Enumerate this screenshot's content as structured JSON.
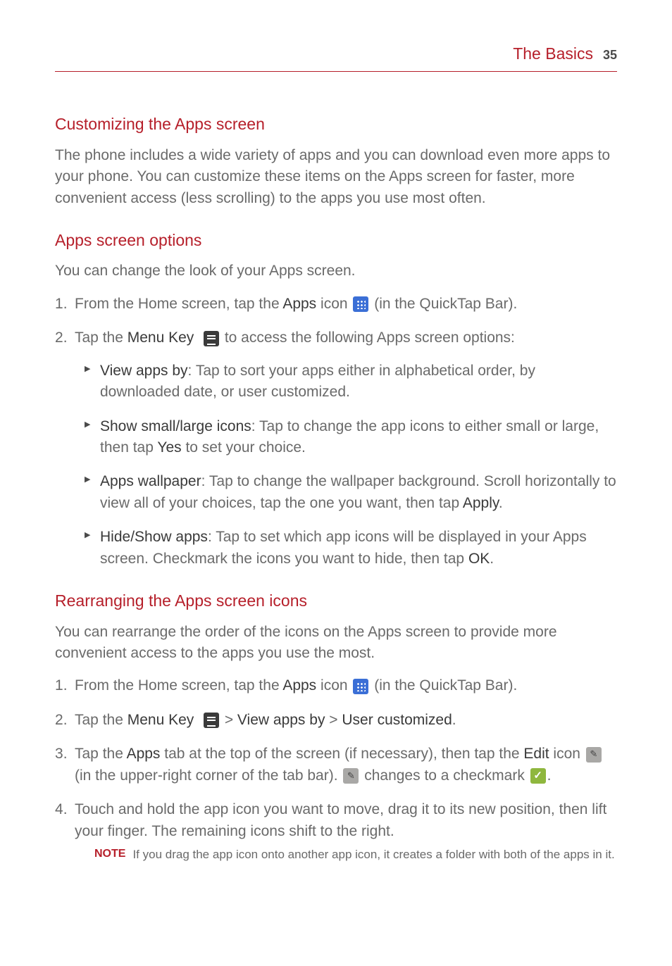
{
  "header": {
    "section": "The Basics",
    "page": "35"
  },
  "s1": {
    "title": "Customizing the Apps screen",
    "body": "The phone includes a wide variety of apps and you can download even more apps to your phone. You can customize these items on the Apps screen for faster, more convenient access (less scrolling) to the apps you use most often."
  },
  "s2": {
    "title": "Apps screen options",
    "body": "You can change the look of your Apps screen.",
    "step1_a": "From the Home screen, tap the ",
    "step1_b": "Apps",
    "step1_c": " icon ",
    "step1_d": " (in the QuickTap Bar).",
    "step2_a": "Tap the ",
    "step2_b": "Menu Key",
    "step2_c": " to access the following Apps screen options:",
    "bullets": {
      "b1_a": "View apps by",
      "b1_b": ": Tap to sort your apps either in alphabetical order, by downloaded date, or user customized.",
      "b2_a": "Show small/large icons",
      "b2_b": ": Tap to change the app icons to either small or large, then tap ",
      "b2_c": "Yes",
      "b2_d": " to set your choice.",
      "b3_a": "Apps wallpaper",
      "b3_b": ": Tap to change the wallpaper background. Scroll horizontally to view all of your choices, tap the one you want, then tap ",
      "b3_c": "Apply",
      "b3_d": ".",
      "b4_a": "Hide/Show apps",
      "b4_b": ": Tap to set which app icons will be displayed in your Apps screen. Checkmark the icons you want to hide, then tap ",
      "b4_c": "OK",
      "b4_d": "."
    }
  },
  "s3": {
    "title": "Rearranging the Apps screen icons",
    "body": "You can rearrange the order of the icons on the Apps screen to provide more convenient access to the apps you use the most.",
    "step1_a": "From the Home screen, tap the ",
    "step1_b": "Apps",
    "step1_c": " icon ",
    "step1_d": " (in the QuickTap Bar).",
    "step2_a": "Tap the ",
    "step2_b": "Menu Key",
    "step2_c": " > ",
    "step2_d": "View apps by",
    "step2_e": " > ",
    "step2_f": "User customized",
    "step2_g": ".",
    "step3_a": "Tap the ",
    "step3_b": "Apps",
    "step3_c": " tab at the top of the screen (if necessary), then tap the ",
    "step3_d": "Edit",
    "step3_e": " icon ",
    "step3_f": " (in the upper-right corner of the tab bar). ",
    "step3_g": " changes to a checkmark ",
    "step3_h": ".",
    "step4": "Touch and hold the app icon you want to move, drag it to its new position, then lift your finger. The remaining icons shift to the right.",
    "note_label": "NOTE",
    "note_text": "If you drag the app icon onto another app icon, it creates a folder with both of the apps in it."
  }
}
